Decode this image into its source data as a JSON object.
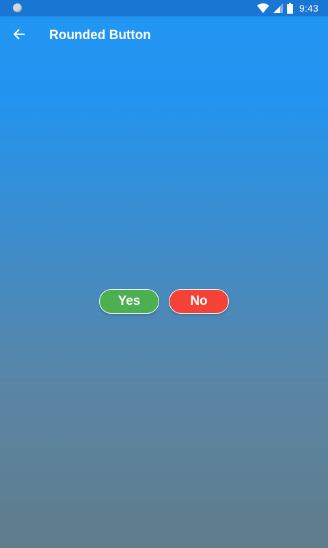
{
  "status_bar": {
    "time": "9:43",
    "icons": [
      "notification-dot-icon",
      "wifi-icon",
      "cellular-signal-icon",
      "battery-icon"
    ]
  },
  "app_bar": {
    "title": "Rounded Button",
    "back_icon": "arrow-back-icon"
  },
  "buttons": {
    "yes": {
      "label": "Yes",
      "color": "#4CAF50"
    },
    "no": {
      "label": "No",
      "color": "#F44336"
    }
  },
  "colors": {
    "status_bar": "#1976D2",
    "gradient_top": "#2196F3",
    "gradient_bottom": "#607D8B",
    "border": "#FFFFFF"
  }
}
